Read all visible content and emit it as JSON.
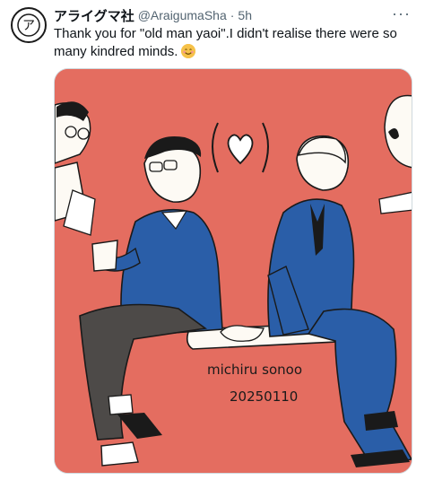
{
  "account": {
    "display_name": "アライグマ社",
    "handle": "@AraigumaSha",
    "separator": "·",
    "time": "5h",
    "avatar_glyph": "ア"
  },
  "tweet": {
    "text": "Thank you for \"old man yaoi\".I didn't realise there were so many kindred minds."
  },
  "media": {
    "signature": "michiru sonoo",
    "date": "20250110",
    "background_color": "#e46d60",
    "suit_color": "#2a5ea8"
  },
  "icons": {
    "more": "more-icon",
    "emoji": "smiling-face-emoji"
  }
}
